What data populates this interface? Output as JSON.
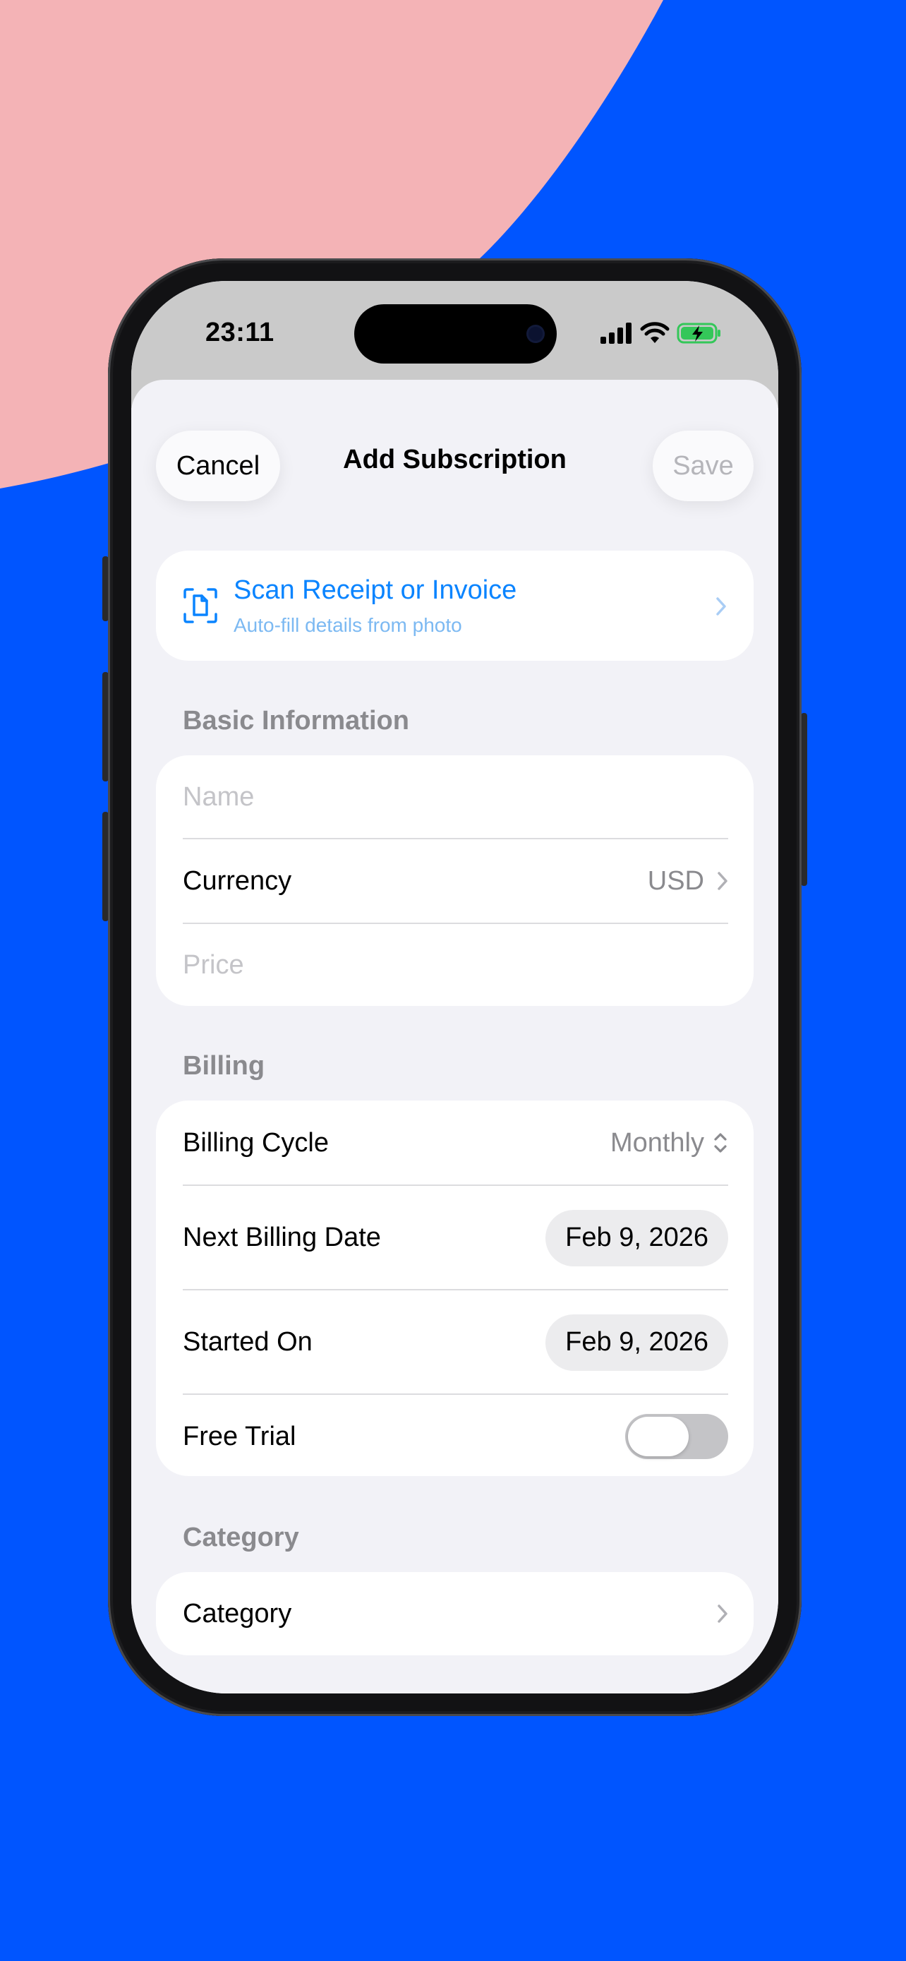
{
  "status_bar": {
    "time": "23:11"
  },
  "nav": {
    "cancel_label": "Cancel",
    "title": "Add Subscription",
    "save_label": "Save"
  },
  "scan": {
    "title": "Scan Receipt or Invoice",
    "subtitle": "Auto-fill details from photo",
    "icon": "document-scan-icon"
  },
  "sections": {
    "basic": {
      "header": "Basic Information",
      "name_placeholder": "Name",
      "currency_label": "Currency",
      "currency_value": "USD",
      "price_placeholder": "Price"
    },
    "billing": {
      "header": "Billing",
      "cycle_label": "Billing Cycle",
      "cycle_value": "Monthly",
      "next_label": "Next Billing Date",
      "next_value": "Feb 9, 2026",
      "started_label": "Started On",
      "started_value": "Feb 9, 2026",
      "trial_label": "Free Trial",
      "trial_on": false
    },
    "category": {
      "header": "Category",
      "row_label": "Category"
    }
  },
  "colors": {
    "background_blue": "#0055FF",
    "background_pink": "#F4B3B6",
    "accent_blue": "#0A84FF",
    "battery_green": "#34C759"
  }
}
